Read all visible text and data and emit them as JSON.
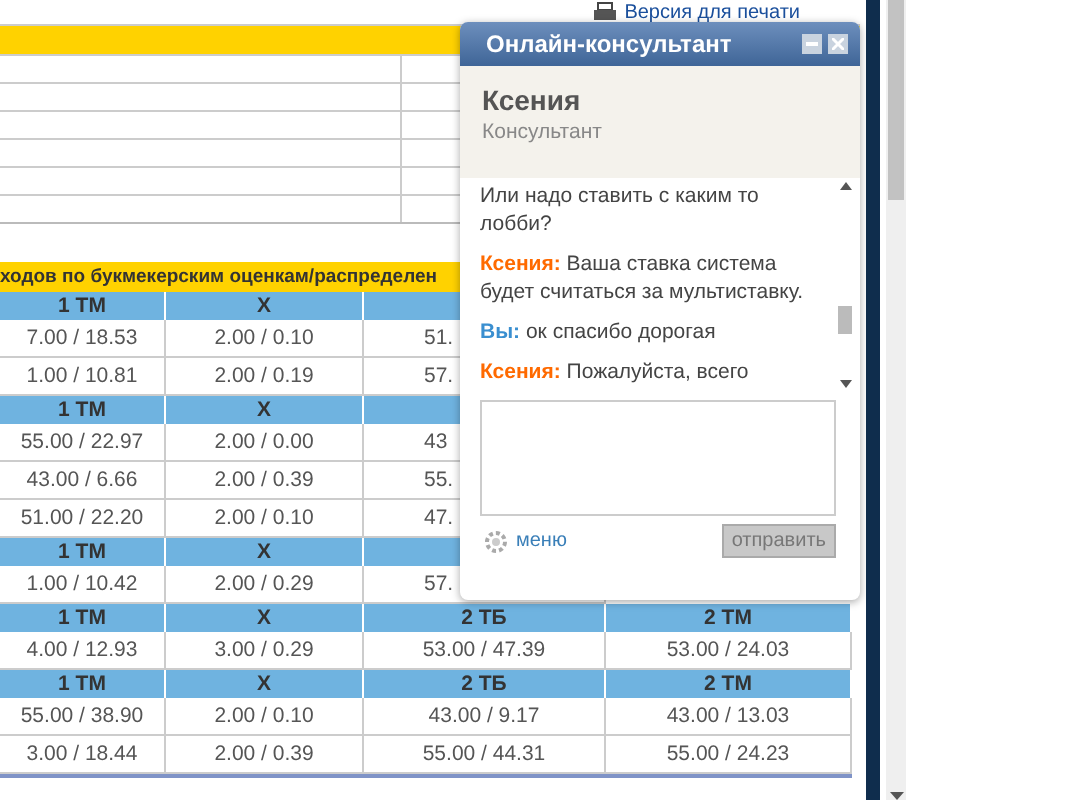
{
  "print_link": "Версия для печати",
  "odds_table": {
    "title": "ходов по букмекерским оценкам/распределен",
    "rows": [
      {
        "kind": "header",
        "cells": [
          "1 ТМ",
          "X"
        ]
      },
      {
        "kind": "data",
        "cells": [
          "7.00 / 18.53",
          "2.00 / 0.10",
          "51."
        ]
      },
      {
        "kind": "data",
        "cells": [
          "1.00 / 10.81",
          "2.00 / 0.19",
          "57."
        ]
      },
      {
        "kind": "header",
        "cells": [
          "1 ТМ",
          "X"
        ]
      },
      {
        "kind": "data",
        "cells": [
          "55.00 / 22.97",
          "2.00 / 0.00",
          "43"
        ]
      },
      {
        "kind": "data",
        "cells": [
          "43.00 / 6.66",
          "2.00 / 0.39",
          "55."
        ]
      },
      {
        "kind": "data",
        "cells": [
          "51.00 / 22.20",
          "2.00 / 0.10",
          "47."
        ]
      },
      {
        "kind": "header",
        "cells": [
          "1 ТМ",
          "X"
        ]
      },
      {
        "kind": "data",
        "cells": [
          "1.00 / 10.42",
          "2.00 / 0.29",
          "57."
        ]
      },
      {
        "kind": "header",
        "cells": [
          "1 ТМ",
          "X",
          "2 ТБ",
          "2 ТМ"
        ]
      },
      {
        "kind": "data",
        "cells": [
          "4.00 / 12.93",
          "3.00 / 0.29",
          "53.00 / 47.39",
          "53.00 / 24.03"
        ]
      },
      {
        "kind": "header",
        "cells": [
          "1 ТМ",
          "X",
          "2 ТБ",
          "2 ТМ"
        ]
      },
      {
        "kind": "data",
        "cells": [
          "55.00 / 38.90",
          "2.00 / 0.10",
          "43.00 / 9.17",
          "43.00 / 13.03"
        ]
      },
      {
        "kind": "data",
        "cells": [
          "3.00 / 18.44",
          "2.00 / 0.39",
          "55.00 / 44.31",
          "55.00 / 24.23"
        ]
      }
    ]
  },
  "chat": {
    "title": "Онлайн-консультант",
    "operator_name": "Ксения",
    "operator_role": "Консультант",
    "messages": [
      {
        "kind": "continuation",
        "text": "Или надо ставить с каким то лобби?"
      },
      {
        "kind": "operator",
        "author": "Ксения:",
        "text": "Ваша ставка система будет считаться за мультиставку."
      },
      {
        "kind": "visitor",
        "author": "Вы:",
        "text": "ок спасибо дорогая"
      },
      {
        "kind": "operator",
        "author": "Ксения:",
        "text": "Пожалуйста, всего"
      }
    ],
    "menu_label": "меню",
    "send_label": "отправить",
    "send_disabled": true
  }
}
